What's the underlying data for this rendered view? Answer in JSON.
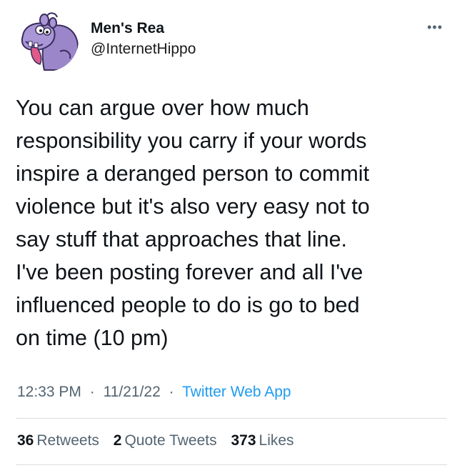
{
  "author": {
    "display_name": "Men's Rea",
    "handle": "@InternetHippo",
    "avatar_icon": "purple-hippo-avatar"
  },
  "more_label": "•••",
  "tweet_text": "You can argue over how much\nresponsibility you carry if your words\ninspire a deranged person to commit\nviolence but it's also very easy not to\nsay stuff that approaches that line.\nI've been posting forever and all I've\ninfluenced people to do is go to bed\non time (10 pm)",
  "meta": {
    "time": "12:33 PM",
    "date": "11/21/22",
    "source": "Twitter Web App",
    "separator": "·"
  },
  "stats": {
    "retweets_count": "36",
    "retweets_label": "Retweets",
    "quotes_count": "2",
    "quotes_label": "Quote Tweets",
    "likes_count": "373",
    "likes_label": "Likes"
  },
  "colors": {
    "link": "#1d9bf0",
    "muted": "#536471",
    "text": "#0f1419",
    "avatar_purple": "#9b86c9"
  }
}
